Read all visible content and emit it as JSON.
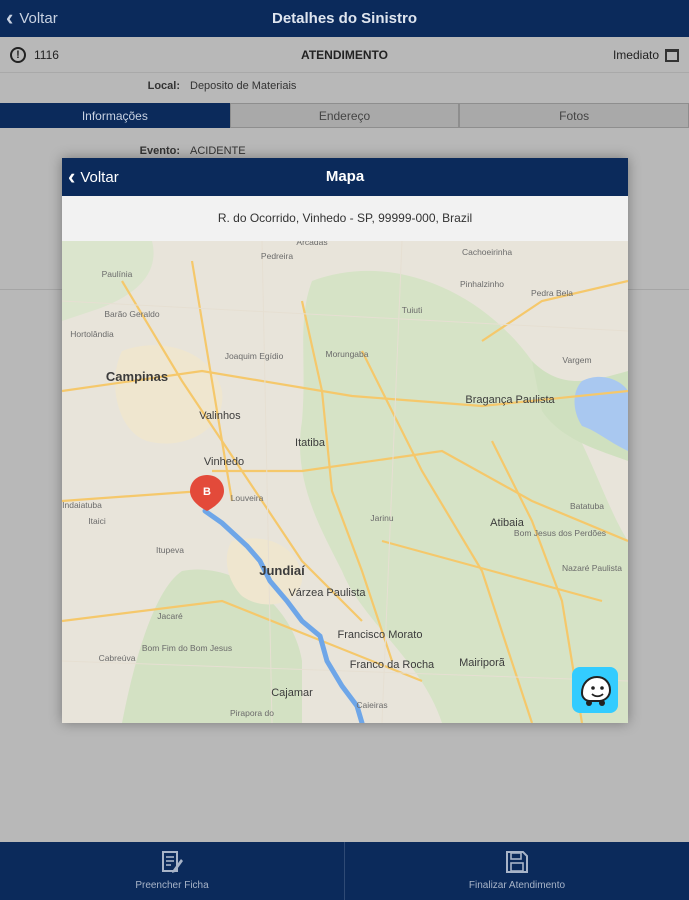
{
  "header": {
    "back_label": "Voltar",
    "title": "Detalhes do Sinistro"
  },
  "info": {
    "icon": "alert-circle-icon",
    "number": "1116",
    "status": "ATENDIMENTO",
    "priority": "Imediato"
  },
  "local": {
    "label": "Local:",
    "value": "Deposito de Materiais"
  },
  "tabs": [
    {
      "label": "Informações",
      "active": true
    },
    {
      "label": "Endereço",
      "active": false
    },
    {
      "label": "Fotos",
      "active": false
    }
  ],
  "evento": {
    "label": "Evento:",
    "value": "ACIDENTE"
  },
  "modal": {
    "back_label": "Voltar",
    "title": "Mapa",
    "address": "R. do Ocorrido, Vinhedo - SP, 99999-000, Brazil",
    "map": {
      "pin_label": "B",
      "places": [
        {
          "name": "Campinas",
          "cls": "big"
        },
        {
          "name": "Valinhos",
          "cls": "mid"
        },
        {
          "name": "Vinhedo",
          "cls": "mid"
        },
        {
          "name": "Louveira",
          "cls": "small"
        },
        {
          "name": "Itatiba",
          "cls": "mid"
        },
        {
          "name": "Jundiaí",
          "cls": "big"
        },
        {
          "name": "Várzea Paulista",
          "cls": "mid"
        },
        {
          "name": "Francisco Morato",
          "cls": "mid"
        },
        {
          "name": "Franco da Rocha",
          "cls": "mid"
        },
        {
          "name": "Cajamar",
          "cls": "mid"
        },
        {
          "name": "Atibaia",
          "cls": "mid"
        },
        {
          "name": "Bragança Paulista",
          "cls": "mid"
        },
        {
          "name": "Mairiporã",
          "cls": "mid"
        },
        {
          "name": "Morungaba",
          "cls": "small"
        },
        {
          "name": "Tuiuti",
          "cls": "small"
        },
        {
          "name": "Pinhalzinho",
          "cls": "small"
        },
        {
          "name": "Pedra Bela",
          "cls": "small"
        },
        {
          "name": "Vargem",
          "cls": "small"
        },
        {
          "name": "Cachoeirinha",
          "cls": "small"
        },
        {
          "name": "Pedreira",
          "cls": "small"
        },
        {
          "name": "Paulínia",
          "cls": "small"
        },
        {
          "name": "Jarinu",
          "cls": "small"
        },
        {
          "name": "Itupeva",
          "cls": "small"
        },
        {
          "name": "Jacaré",
          "cls": "small"
        },
        {
          "name": "Cabreúva",
          "cls": "small"
        },
        {
          "name": "Bom Fim do Bom Jesus",
          "cls": "small"
        },
        {
          "name": "Batatuba",
          "cls": "small"
        },
        {
          "name": "Nazaré Paulista",
          "cls": "small"
        },
        {
          "name": "Bom Jesus dos Perdões",
          "cls": "small"
        },
        {
          "name": "Joaquim Egídio",
          "cls": "small"
        },
        {
          "name": "Barão Geraldo",
          "cls": "small"
        },
        {
          "name": "Indaiatuba",
          "cls": "small"
        },
        {
          "name": "Itaici",
          "cls": "small"
        },
        {
          "name": "Hortolândia",
          "cls": "small"
        },
        {
          "name": "Pirapora do",
          "cls": "small"
        },
        {
          "name": "Caieiras",
          "cls": "small"
        },
        {
          "name": "Arcadas",
          "cls": "small"
        }
      ]
    }
  },
  "footer": {
    "fill_label": "Preencher Ficha",
    "finish_label": "Finalizar Atendimento"
  }
}
